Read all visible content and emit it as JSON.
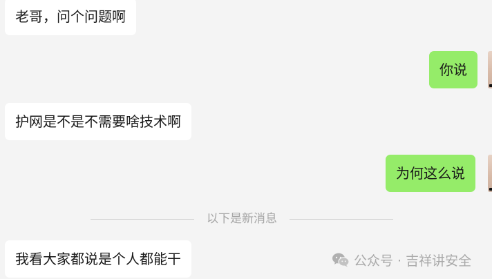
{
  "messages": [
    {
      "side": "incoming",
      "text": "老哥，问个问题啊"
    },
    {
      "side": "outgoing",
      "text": "你说"
    },
    {
      "side": "incoming",
      "text": "护网是不是不需要啥技术啊"
    },
    {
      "side": "outgoing",
      "text": "为何这么说"
    },
    {
      "side": "incoming",
      "text": "我看大家都说是个人都能干"
    }
  ],
  "divider": {
    "label": "以下是新消息"
  },
  "watermark": {
    "text": "公众号 · 吉祥讲安全",
    "icon": "wechat-icon"
  },
  "colors": {
    "background": "#f4f4f4",
    "incoming_bubble": "#ffffff",
    "outgoing_bubble": "#95ec69",
    "divider_text": "#a6a6a6"
  }
}
